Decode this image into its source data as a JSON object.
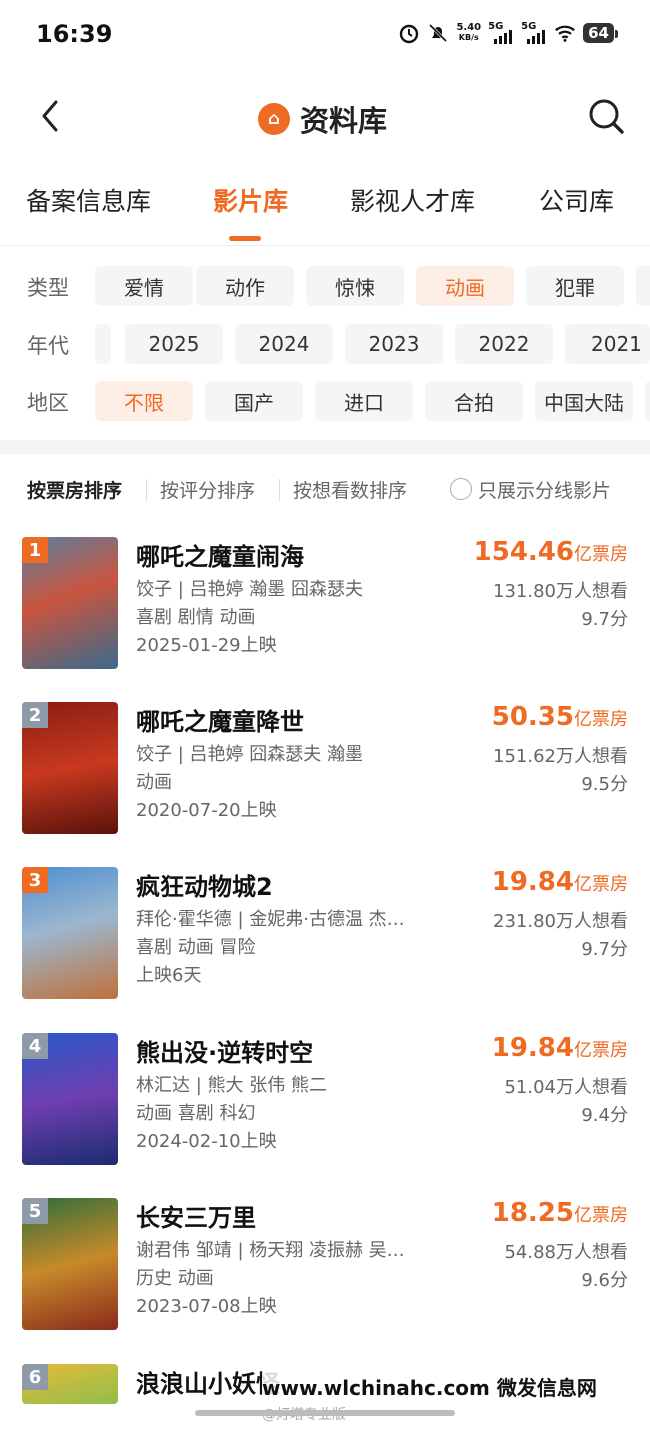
{
  "status_bar": {
    "time": "16:39",
    "speed_value": "5.40",
    "speed_unit": "KB/s",
    "net1": "5G",
    "net2": "5G",
    "battery": "64"
  },
  "nav": {
    "title": "资料库",
    "logo_glyph": "⌂"
  },
  "tabs": [
    {
      "label": "备案信息库",
      "active": false
    },
    {
      "label": "影片库",
      "active": true
    },
    {
      "label": "影视人才库",
      "active": false
    },
    {
      "label": "公司库",
      "active": false
    }
  ],
  "filters": {
    "type": {
      "label": "类型",
      "options": [
        "爱情",
        "动作",
        "惊悚",
        "动画",
        "犯罪"
      ],
      "selected": "动画"
    },
    "era": {
      "label": "年代",
      "options": [
        "2025",
        "2024",
        "2023",
        "2022",
        "2021"
      ]
    },
    "region": {
      "label": "地区",
      "options": [
        "不限",
        "国产",
        "进口",
        "合拍",
        "中国大陆"
      ],
      "selected": "不限"
    }
  },
  "sort": {
    "options": [
      "按票房排序",
      "按评分排序",
      "按想看数排序"
    ],
    "active": "按票房排序",
    "split_toggle_label": "只展示分线影片"
  },
  "movies": [
    {
      "rank": "1",
      "title": "哪吒之魔童闹海",
      "cast": "饺子 | 吕艳婷 瀚墨 囧森瑟夫",
      "genres": "喜剧 剧情 动画",
      "release": "2025-01-29上映",
      "box_office": "154.46",
      "box_unit": "亿票房",
      "want": "131.80万人想看",
      "score": "9.7分"
    },
    {
      "rank": "2",
      "title": "哪吒之魔童降世",
      "cast": "饺子 | 吕艳婷 囧森瑟夫 瀚墨",
      "genres": "动画",
      "release": "2020-07-20上映",
      "box_office": "50.35",
      "box_unit": "亿票房",
      "want": "151.62万人想看",
      "score": "9.5分"
    },
    {
      "rank": "3",
      "title": "疯狂动物城2",
      "cast": "拜伦·霍华德 | 金妮弗·古德温 杰…",
      "genres": "喜剧 动画 冒险",
      "release": "上映6天",
      "box_office": "19.84",
      "box_unit": "亿票房",
      "want": "231.80万人想看",
      "score": "9.7分"
    },
    {
      "rank": "4",
      "title": "熊出没·逆转时空",
      "cast": "林汇达 | 熊大 张伟 熊二",
      "genres": "动画 喜剧 科幻",
      "release": "2024-02-10上映",
      "box_office": "19.84",
      "box_unit": "亿票房",
      "want": "51.04万人想看",
      "score": "9.4分"
    },
    {
      "rank": "5",
      "title": "长安三万里",
      "cast": "谢君伟 邹靖 | 杨天翔 凌振赫 吴…",
      "genres": "历史 动画",
      "release": "2023-07-08上映",
      "box_office": "18.25",
      "box_unit": "亿票房",
      "want": "54.88万人想看",
      "score": "9.6分"
    },
    {
      "rank": "6",
      "title": "浪浪山小妖怪"
    }
  ],
  "watermark": "www.wlchinahc.com 微发信息网",
  "credit": "@灯塔专业版",
  "colors": {
    "accent": "#ef6a22",
    "rank_top": "#ef6a22",
    "rank_other": "#8f9aa8"
  }
}
